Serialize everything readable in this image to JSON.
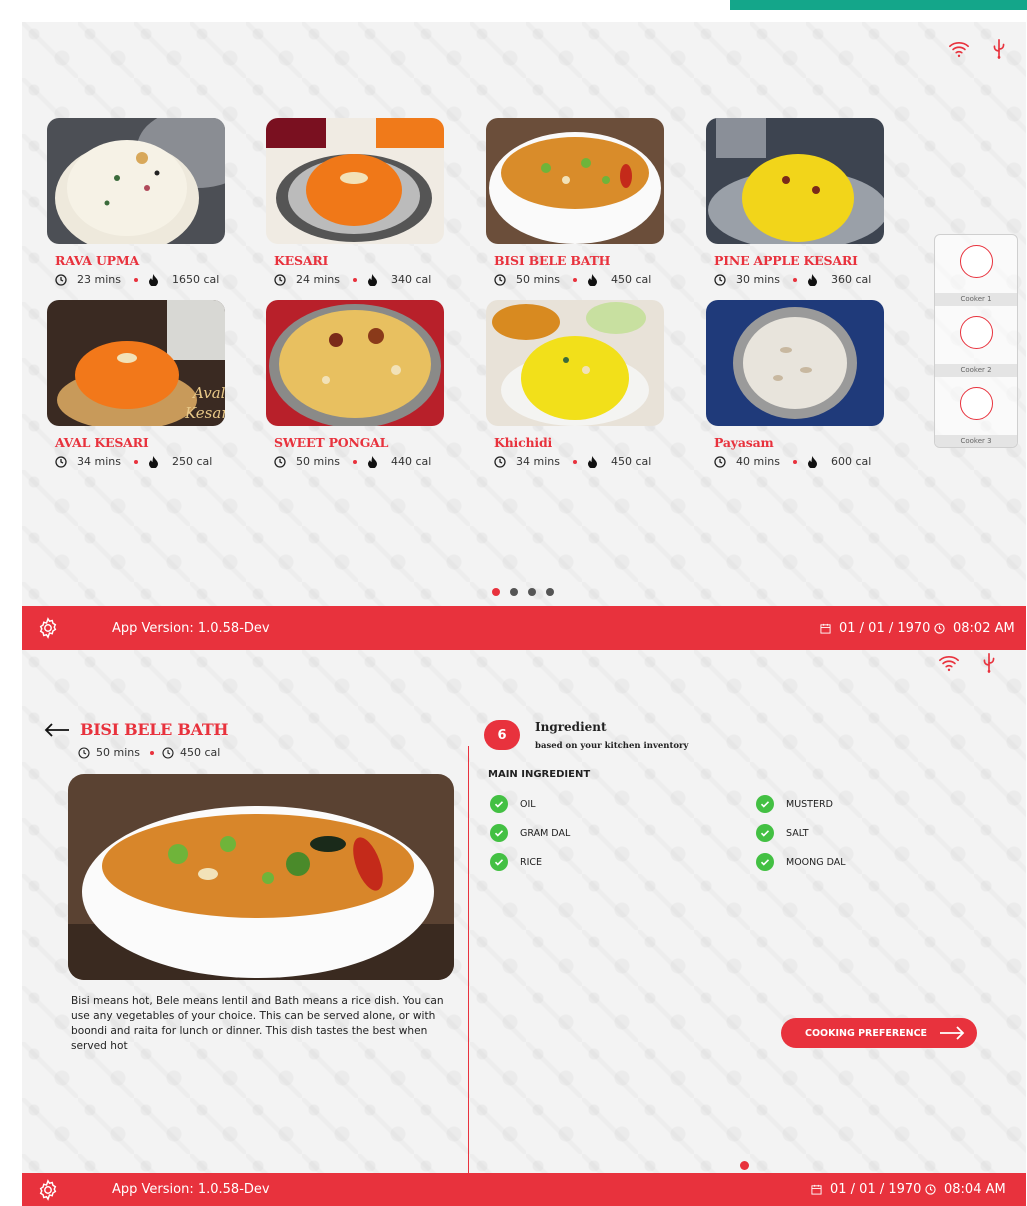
{
  "colors": {
    "accent": "#e8323d",
    "check": "#43c043",
    "teal": "#14a68a"
  },
  "recipes": [
    {
      "name": "RAVA UPMA",
      "time": "23 mins",
      "cal": "1650 cal"
    },
    {
      "name": "KESARI",
      "time": "24 mins",
      "cal": "340 cal"
    },
    {
      "name": "BISI BELE BATH",
      "time": "50 mins",
      "cal": "450 cal"
    },
    {
      "name": "PINE APPLE KESARI",
      "time": "30 mins",
      "cal": "360 cal"
    },
    {
      "name": "AVAL KESARI",
      "time": "34 mins",
      "cal": "250 cal"
    },
    {
      "name": "SWEET PONGAL",
      "time": "50 mins",
      "cal": "440 cal"
    },
    {
      "name": "Khichidi",
      "time": "34 mins",
      "cal": "450 cal"
    },
    {
      "name": "Payasam",
      "time": "40 mins",
      "cal": "600 cal"
    }
  ],
  "aval_overlay": [
    "Aval",
    "Kesari"
  ],
  "cookers": [
    "Cooker 1",
    "Cooker 2",
    "Cooker 3"
  ],
  "footer1": {
    "version": "App Version: 1.0.58-Dev",
    "date": "01 / 01 / 1970",
    "time": "08:02 AM"
  },
  "footer2": {
    "version": "App Version: 1.0.58-Dev",
    "date": "01 / 01 / 1970",
    "time": "08:04 AM"
  },
  "detail": {
    "title": "BISI BELE BATH",
    "time": "50 mins",
    "cal": "450 cal",
    "description": "Bisi means hot, Bele means lentil and Bath means a rice dish. You can use any vegetables of your choice. This can be served alone, or with boondi and raita for lunch or dinner. This dish tastes the best when served hot",
    "ingredient_count": "6",
    "ingredient_heading": "Ingredient",
    "ingredient_sub": "based on your kitchen inventory",
    "main_heading": "MAIN INGREDIENT",
    "ingredients_left": [
      "OIL",
      "GRAM DAL",
      "RICE"
    ],
    "ingredients_right": [
      "MUSTERD",
      "SALT",
      "MOONG DAL"
    ],
    "cta": "COOKING PREFERENCE"
  },
  "icons": [
    "wifi-icon",
    "usb-icon",
    "clock-icon",
    "flame-icon",
    "gear-icon",
    "calendar-icon",
    "check-icon",
    "arrow-left-icon",
    "arrow-right-icon"
  ]
}
